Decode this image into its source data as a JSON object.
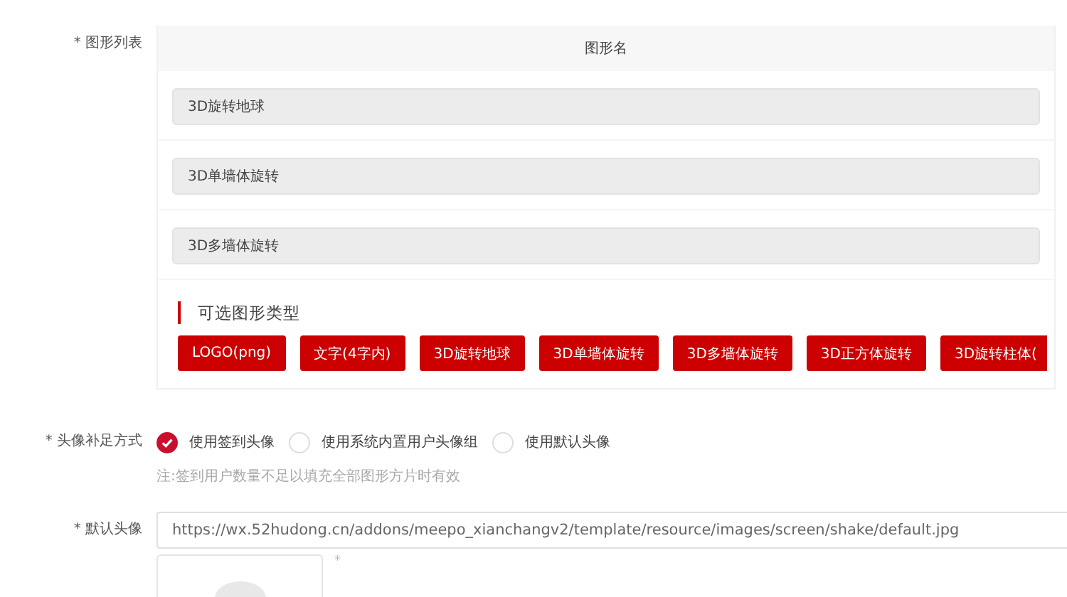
{
  "shape_list": {
    "label": "* 图形列表",
    "column_header": "图形名",
    "items": [
      {
        "value": "3D旋转地球"
      },
      {
        "value": "3D单墙体旋转"
      },
      {
        "value": "3D多墙体旋转"
      }
    ],
    "types_title": "可选图形类型",
    "types": [
      "LOGO(png)",
      "文字(4字内)",
      "3D旋转地球",
      "3D单墙体旋转",
      "3D多墙体旋转",
      "3D正方体旋转",
      "3D旋转柱体("
    ]
  },
  "avatar_fill": {
    "label": "* 头像补足方式",
    "options": [
      {
        "label": "使用签到头像",
        "selected": true
      },
      {
        "label": "使用系统内置用户头像组",
        "selected": false
      },
      {
        "label": "使用默认头像",
        "selected": false
      }
    ],
    "note": "注:签到用户数量不足以填充全部图形方片时有效"
  },
  "default_avatar": {
    "label": "* 默认头像",
    "value": "https://wx.52hudong.cn/addons/meepo_xianchangv2/template/resource/images/screen/shake/default.jpg",
    "mark": "*"
  }
}
